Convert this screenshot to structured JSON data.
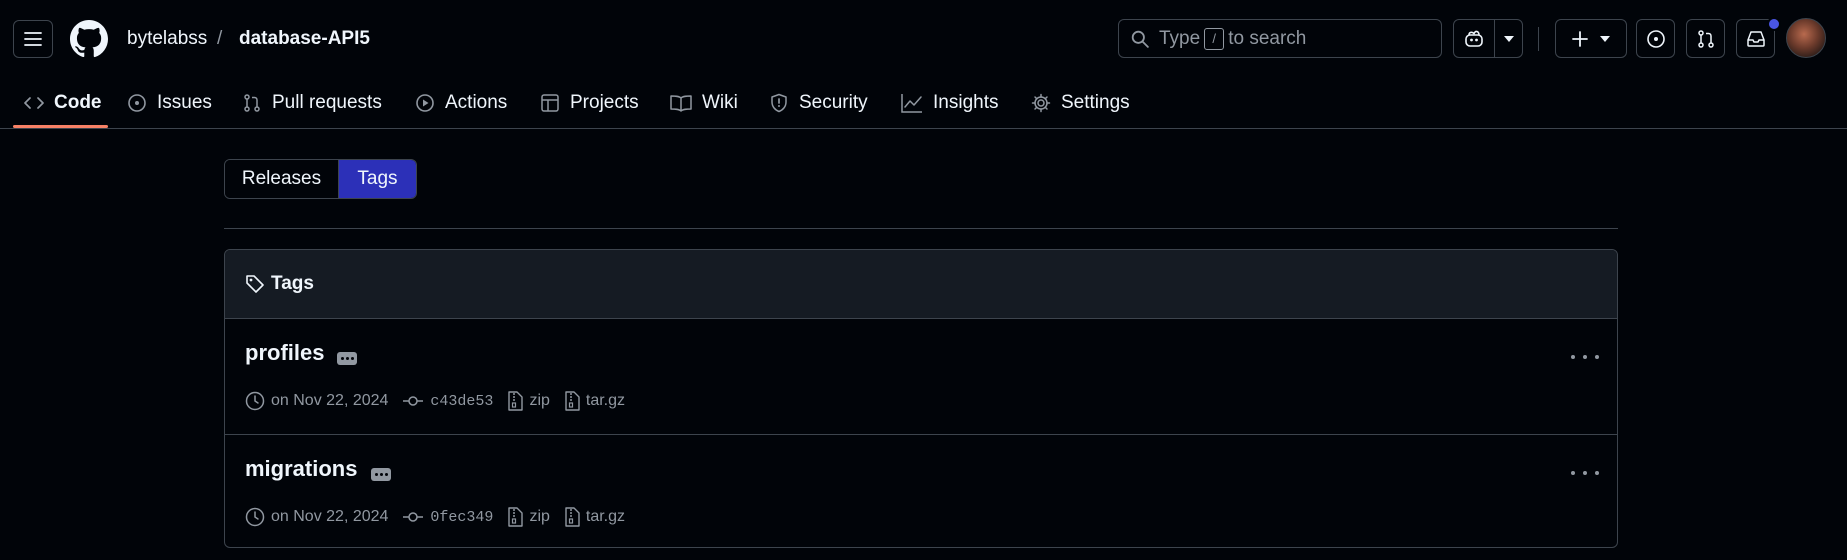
{
  "header": {
    "owner": "bytelabss",
    "separator": "/",
    "repo": "database-API5",
    "search_prefix": "Type",
    "search_key": "/",
    "search_suffix": "to search"
  },
  "nav": {
    "tabs": [
      {
        "label": "Code"
      },
      {
        "label": "Issues"
      },
      {
        "label": "Pull requests"
      },
      {
        "label": "Actions"
      },
      {
        "label": "Projects"
      },
      {
        "label": "Wiki"
      },
      {
        "label": "Security"
      },
      {
        "label": "Insights"
      },
      {
        "label": "Settings"
      }
    ]
  },
  "toggle": {
    "releases": "Releases",
    "tags": "Tags"
  },
  "tags_box": {
    "title": "Tags",
    "items": [
      {
        "name": "profiles",
        "date": "on Nov 22, 2024",
        "commit": "c43de53",
        "zip": "zip",
        "targz": "tar.gz"
      },
      {
        "name": "migrations",
        "date": "on Nov 22, 2024",
        "commit": "0fec349",
        "zip": "zip",
        "targz": "tar.gz"
      }
    ]
  },
  "colors": {
    "background": "#010409",
    "accent_underline": "#f78166",
    "selected_toggle": "#2c30b8",
    "notification_dot": "#4a56e6"
  },
  "icons": [
    "hamburger-icon",
    "github-logo-icon",
    "search-icon",
    "copilot-icon",
    "plus-icon",
    "issue-icon",
    "pull-request-icon",
    "inbox-icon",
    "tag-icon",
    "clock-icon",
    "commit-icon",
    "file-zip-icon"
  ]
}
